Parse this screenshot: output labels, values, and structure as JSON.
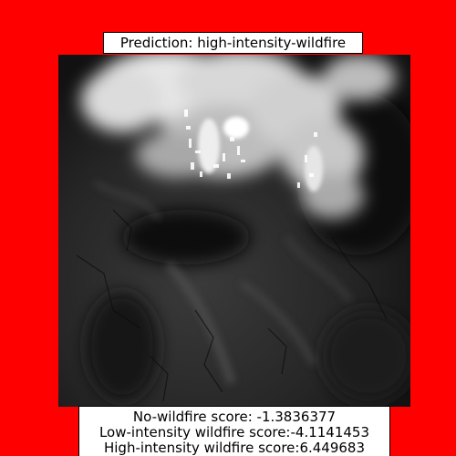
{
  "prediction_title": "Prediction: high-intensity-wildfire",
  "scores": {
    "no_wildfire": "No-wildfire score: -1.3836377",
    "low_intensity": "Low-intensity wildfire score:-4.1141453",
    "high_intensity": "High-intensity wildfire score:6.449683"
  },
  "colors": {
    "background": "#ff0000",
    "label_box": "#ffffff",
    "border": "#000000"
  }
}
